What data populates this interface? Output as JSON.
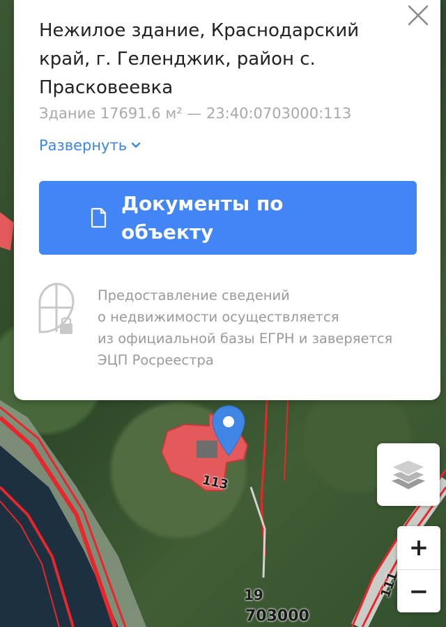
{
  "card": {
    "title": "Нежилое здание, Краснодарский край, г. Геленджик, район с. Прасковеевка",
    "subtitle": "Здание 17691.6 м² — 23:40:0703000:113",
    "expand_label": "Развернуть",
    "documents_button_label": "Документы по объекту",
    "notice_lines": [
      "Предоставление сведений",
      "о недвижимости осуществляется",
      "из официальной базы ЕГРН и заверяется",
      "ЭЦП Росреестра"
    ],
    "accent_color": "#4285f4",
    "link_color": "#3a86e0"
  },
  "map": {
    "parcel_label_113": "113",
    "parcel_label_19": "19",
    "block_label": "703000",
    "road_label": "111",
    "parcel_color": "#e45a5a",
    "boundary_color": "#e8262b"
  },
  "controls": {
    "zoom_in": "+",
    "zoom_out": "−",
    "layers_icon": "layers-icon",
    "close_icon": "close-icon"
  }
}
